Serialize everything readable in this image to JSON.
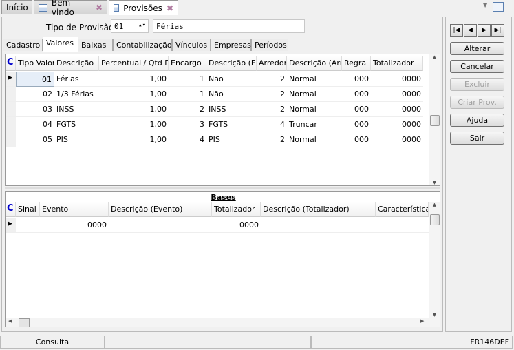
{
  "tabs": [
    {
      "label": "Início"
    },
    {
      "label": "Bem vindo",
      "close": "✖"
    },
    {
      "label": "Provisões",
      "close": "✖"
    }
  ],
  "form": {
    "tipo_label": "Tipo de Provisão:",
    "tipo_code": "01",
    "tipo_desc": "Férias"
  },
  "inner_tabs": [
    "Cadastro",
    "Valores",
    "Baixas",
    "Contabilização",
    "Vínculos",
    "Empresas",
    "Períodos"
  ],
  "grid1": {
    "corner": "C",
    "columns": [
      "Tipo Valor",
      "Descrição",
      "Percentual / Qtd D",
      "Encargo",
      "Descrição (En",
      "Arredor",
      "Descrição (Arre",
      "Regra",
      "Totalizador"
    ],
    "rows": [
      [
        "01",
        "Férias",
        "1,00",
        "1",
        "Não",
        "2",
        "Normal",
        "000",
        "0000"
      ],
      [
        "02",
        "1/3 Férias",
        "1,00",
        "1",
        "Não",
        "2",
        "Normal",
        "000",
        "0000"
      ],
      [
        "03",
        "INSS",
        "1,00",
        "2",
        "INSS",
        "2",
        "Normal",
        "000",
        "0000"
      ],
      [
        "04",
        "FGTS",
        "1,00",
        "3",
        "FGTS",
        "4",
        "Truncar",
        "000",
        "0000"
      ],
      [
        "05",
        "PIS",
        "1,00",
        "4",
        "PIS",
        "2",
        "Normal",
        "000",
        "0000"
      ]
    ]
  },
  "bases": {
    "title": "Bases",
    "corner": "C",
    "columns": [
      "Sinal",
      "Evento",
      "Descrição (Evento)",
      "Totalizador",
      "Descrição (Totalizador)",
      "Característica"
    ],
    "rows": [
      [
        "",
        "0000",
        "",
        "0000",
        "",
        ""
      ]
    ]
  },
  "buttons": {
    "first": "|◀",
    "prev": "◀",
    "next": "▶",
    "last": "▶|",
    "alterar": "Alterar",
    "cancelar": "Cancelar",
    "excluir": "Excluir",
    "criar": "Criar Prov.",
    "ajuda": "Ajuda",
    "sair": "Sair"
  },
  "status": {
    "mode": "Consulta",
    "code": "FR146DEF"
  }
}
